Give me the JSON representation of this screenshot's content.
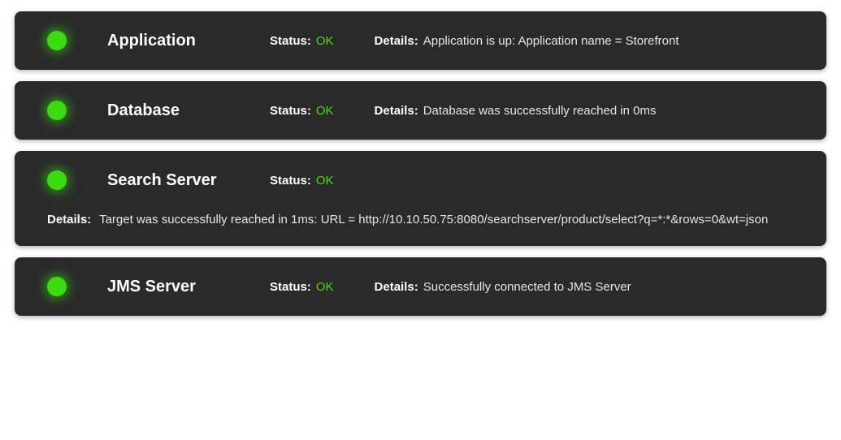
{
  "labels": {
    "status": "Status:",
    "details": "Details:"
  },
  "status_colors": {
    "ok": "#4bdc0f",
    "dot": "#3bdc0f"
  },
  "components": [
    {
      "name": "Application",
      "status": "OK",
      "details": "Application is up: Application name = Storefront",
      "details_inline": true
    },
    {
      "name": "Database",
      "status": "OK",
      "details": "Database was successfully reached in 0ms",
      "details_inline": true
    },
    {
      "name": "Search Server",
      "status": "OK",
      "details": "Target was successfully reached in 1ms: URL = http://10.10.50.75:8080/searchserver/product/select?q=*:*&rows=0&wt=json",
      "details_inline": false
    },
    {
      "name": "JMS Server",
      "status": "OK",
      "details": "Successfully connected to JMS Server",
      "details_inline": true
    }
  ]
}
